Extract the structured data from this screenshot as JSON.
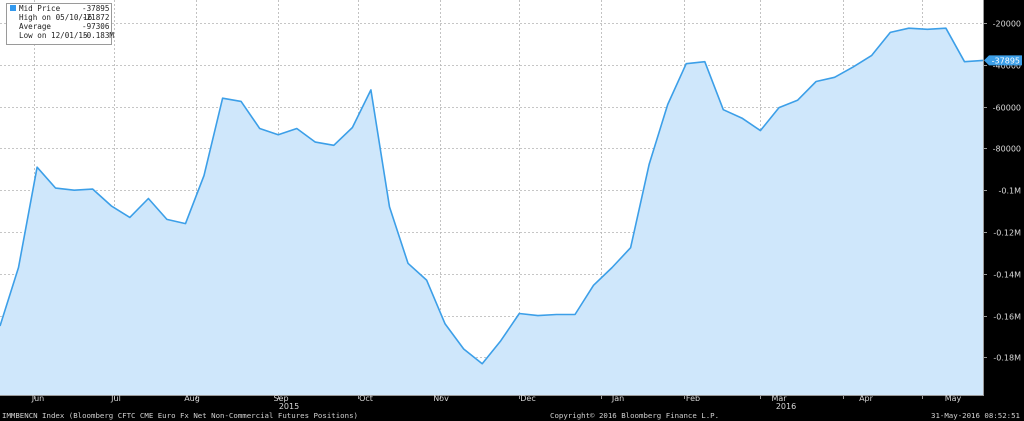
{
  "legend": {
    "rows": [
      {
        "label": "Mid Price",
        "value": "-37895"
      },
      {
        "label": "High on 05/10/16",
        "value": "-21872"
      },
      {
        "label": "Average",
        "value": "-97306"
      },
      {
        "label": "Low on 12/01/15",
        "value": "-0.183M"
      }
    ]
  },
  "footer": {
    "left": "IMMBENCN Index (Bloomberg CFTC CME Euro Fx Net Non-Commercial Futures Positions)",
    "center": "Copyright© 2016 Bloomberg Finance L.P.",
    "right": "31-May-2016 08:52:51"
  },
  "colors": {
    "line": "#3c9fe8",
    "fill": "#cfe7fb",
    "background": "#ffffff",
    "page": "#000000",
    "last_price_tag": "#3c9fe8"
  },
  "chart_data": {
    "type": "area",
    "title": "",
    "xlabel": "",
    "ylabel": "",
    "grid": true,
    "ylim": [
      -198000,
      -9000
    ],
    "x_tick_labels": [
      "Jun",
      "Jul",
      "Aug",
      "Sep",
      "Oct",
      "Nov",
      "Dec",
      "Jan",
      "Feb",
      "Mar",
      "Apr",
      "May"
    ],
    "year_labels": [
      "2015",
      "2016"
    ],
    "y_tick_labels": [
      "-20000",
      "-40000",
      "-60000",
      "-80000",
      "-0.1M",
      "-0.12M",
      "-0.14M",
      "-0.16M",
      "-0.18M"
    ],
    "y_ticks": [
      -20000,
      -40000,
      -60000,
      -80000,
      -100000,
      -120000,
      -140000,
      -160000,
      -180000
    ],
    "last_value_label": "-37895",
    "last_value": -37895,
    "x": [
      "2015-05-19",
      "2015-05-26",
      "2015-06-02",
      "2015-06-09",
      "2015-06-16",
      "2015-06-23",
      "2015-06-30",
      "2015-07-07",
      "2015-07-14",
      "2015-07-21",
      "2015-07-28",
      "2015-08-04",
      "2015-08-11",
      "2015-08-18",
      "2015-08-25",
      "2015-09-01",
      "2015-09-08",
      "2015-09-15",
      "2015-09-22",
      "2015-09-29",
      "2015-10-06",
      "2015-10-13",
      "2015-10-20",
      "2015-10-27",
      "2015-11-03",
      "2015-11-10",
      "2015-11-17",
      "2015-11-24",
      "2015-12-01",
      "2015-12-08",
      "2015-12-15",
      "2015-12-22",
      "2015-12-29",
      "2016-01-05",
      "2016-01-12",
      "2016-01-19",
      "2016-01-26",
      "2016-02-02",
      "2016-02-09",
      "2016-02-16",
      "2016-02-23",
      "2016-03-01",
      "2016-03-08",
      "2016-03-15",
      "2016-03-22",
      "2016-03-29",
      "2016-04-05",
      "2016-04-12",
      "2016-04-19",
      "2016-04-26",
      "2016-05-03",
      "2016-05-10",
      "2016-05-17",
      "2016-05-24"
    ],
    "series": [
      {
        "values": [
          -165000,
          -137000,
          -89000,
          -99000,
          -100000,
          -99500,
          -107500,
          -113000,
          -104000,
          -114000,
          -116000,
          -93000,
          -56000,
          -57500,
          -70500,
          -73500,
          -70500,
          -77000,
          -78500,
          -70000,
          -52000,
          -108000,
          -135000,
          -143000,
          -164000,
          -176000,
          -183000,
          -172000,
          -159000,
          -160000,
          -159500,
          -159500,
          -145500,
          -137000,
          -127500,
          -87500,
          -59000,
          -39500,
          -38500,
          -61500,
          -65500,
          -71500,
          -60500,
          -57000,
          -48000,
          -46000,
          -41000,
          -35500,
          -24500,
          -22500,
          -23000,
          -22500,
          -38500,
          -37895
        ]
      }
    ]
  }
}
